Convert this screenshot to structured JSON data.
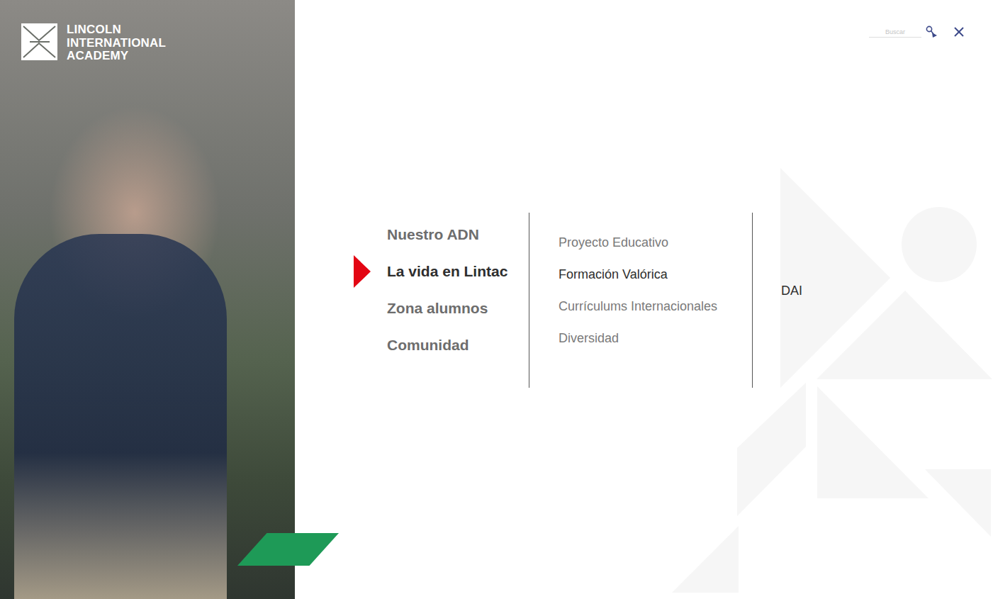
{
  "logo": {
    "lines": [
      "LINCOLN",
      "INTERNATIONAL",
      "ACADEMY"
    ]
  },
  "search": {
    "placeholder": "Buscar"
  },
  "menu": {
    "items": [
      {
        "label": "Nuestro ADN",
        "selected": false
      },
      {
        "label": "La vida en Lintac",
        "selected": true
      },
      {
        "label": "Zona alumnos",
        "selected": false
      },
      {
        "label": "Comunidad",
        "selected": false
      }
    ]
  },
  "submenu": {
    "items": [
      {
        "label": "Proyecto Educativo",
        "selected": false
      },
      {
        "label": "Formación Valórica",
        "selected": true
      },
      {
        "label": "Currículums Internacionales",
        "selected": false
      },
      {
        "label": "Diversidad",
        "selected": false
      }
    ]
  },
  "detail": {
    "items": [
      {
        "label": "DAI"
      }
    ]
  }
}
